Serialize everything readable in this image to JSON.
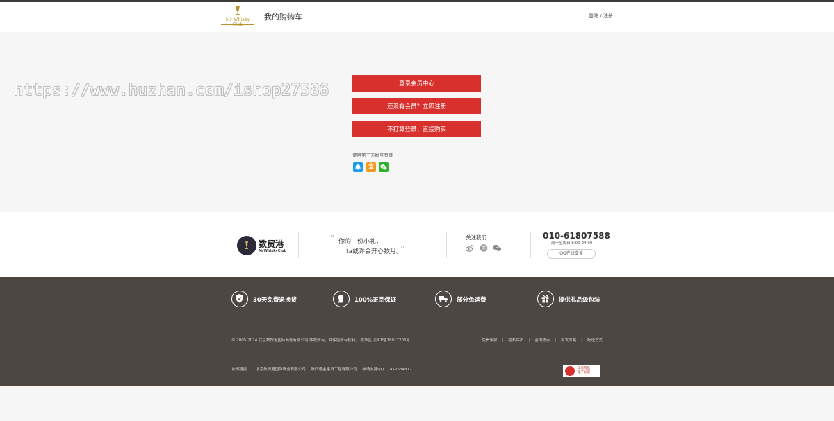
{
  "header": {
    "logo_brand": "Mr Whisky Club",
    "page_title": "我的购物车",
    "login": "登陆",
    "divider": "/",
    "register": "注册"
  },
  "watermark": "https://www.huzhan.com/ishop27586",
  "actions": {
    "member_login": "登录会员中心",
    "register_now": "还没有会员？立即注册",
    "guest_buy": "不打算登录，直接购买"
  },
  "third_party": {
    "label": "使用第三方帐号登录",
    "icons": [
      "qq-icon",
      "alipay-icon",
      "wechat-icon"
    ],
    "alipay_glyph": "支"
  },
  "mid_band": {
    "brand_name": "数贸港",
    "brand_sub": "MrWhiskyClub",
    "quote_line1": "你的一份小礼，",
    "quote_line2": "ta或许会开心数月。",
    "quote_open": "“",
    "quote_close": "”",
    "follow_label": "关注我们",
    "follow_icons": [
      "weibo-icon",
      "douban-icon",
      "wechat-icon"
    ],
    "phone": "010-61807588",
    "hours": "周一至周日 8:00-24:00",
    "qq_button": "QQ在线交谈"
  },
  "footer": {
    "features": [
      {
        "icon": "shield-icon",
        "label": "30天免费退换货"
      },
      {
        "icon": "medal-icon",
        "label": "100%正品保证"
      },
      {
        "icon": "truck-icon",
        "label": "部分免运费"
      },
      {
        "icon": "gift-icon",
        "label": "提供礼品级包装"
      }
    ],
    "copyright": "© 2005-2024 北京数贸港国际商务有限公司 版权所有，并保留所有权利。 龙华区    京ICP备18017206号",
    "links": [
      "免责条款",
      "隐私保护",
      "咨询热点",
      "批发方案",
      "配送方式"
    ],
    "link_sep": "|",
    "friends_label": "友情链接：",
    "friends": [
      "北京数贸港国际商务有限公司",
      "陕西通金建设工程有限公司",
      "申请友链QQ：1452634877"
    ],
    "badge_line1": "工商网监",
    "badge_line2": "电子标识"
  },
  "colors": {
    "accent_red": "#d8302c",
    "footer_bg": "#4c4743",
    "gold": "#b8932d"
  }
}
